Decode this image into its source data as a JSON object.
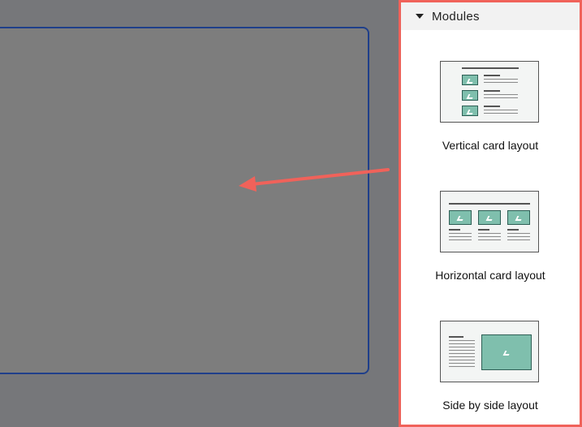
{
  "panel": {
    "title": "Modules",
    "modules": [
      {
        "label": "Vertical card layout",
        "icon": "vertical-card-layout-thumbnail"
      },
      {
        "label": "Horizontal card layout",
        "icon": "horizontal-card-layout-thumbnail"
      },
      {
        "label": "Side by side layout",
        "icon": "side-by-side-layout-thumbnail"
      }
    ]
  },
  "colors": {
    "accent_border": "#f0625a",
    "canvas_border": "#1f3f8a",
    "thumb_image": "#7fbfad"
  }
}
